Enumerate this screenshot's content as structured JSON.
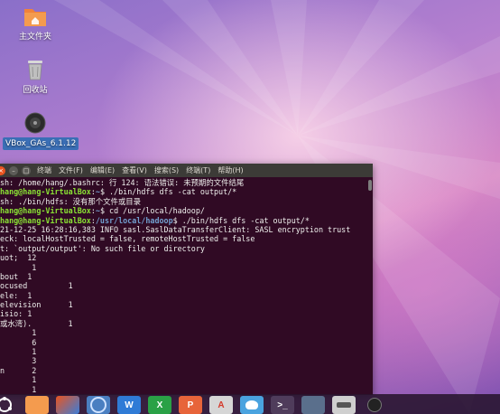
{
  "desktop": {
    "icons": [
      {
        "label": "主文件夹"
      },
      {
        "label": "回收站"
      },
      {
        "label": "VBox_GAs_6.1.12"
      }
    ]
  },
  "terminal": {
    "menu": [
      "终端",
      "文件(F)",
      "编辑(E)",
      "查看(V)",
      "搜索(S)",
      "终端(T)",
      "帮助(H)"
    ],
    "lines": [
      "sh: /home/hang/.bashrc: 行 124: 语法错误: 未预期的文件结尾",
      "hang@hang-VirtualBox:~$ ./bin/hdfs dfs -cat output/*",
      "sh: ./bin/hdfs: 没有那个文件或目录",
      "hang@hang-VirtualBox:~$ cd /usr/local/hadoop/",
      "hang@hang-VirtualBox:/usr/local/hadoop$ ./bin/hdfs dfs -cat output/*",
      "21-12-25 16:28:16,383 INFO sasl.SaslDataTransferClient: SASL encryption trust",
      "eck: localHostTrusted = false, remoteHostTrusted = false",
      "t: `output/output': No such file or directory",
      "uot;  12",
      "       1",
      "bout  1",
      "ocused         1",
      "ele:  1",
      "elevision      1",
      "isio: 1",
      "或水湾).        1",
      "       1",
      "       6",
      "       1",
      "       3",
      "n      2",
      "       1",
      "       1",
      "       1"
    ]
  },
  "dock": {
    "items": [
      "ubuntu-icon",
      "files-icon",
      "chromium-icon",
      "writer-icon",
      "calc-icon",
      "impress-icon",
      "store-icon",
      "dvd-icon",
      "terminal-icon",
      "window-icon",
      "disk-icon",
      "vbox-icon"
    ]
  }
}
